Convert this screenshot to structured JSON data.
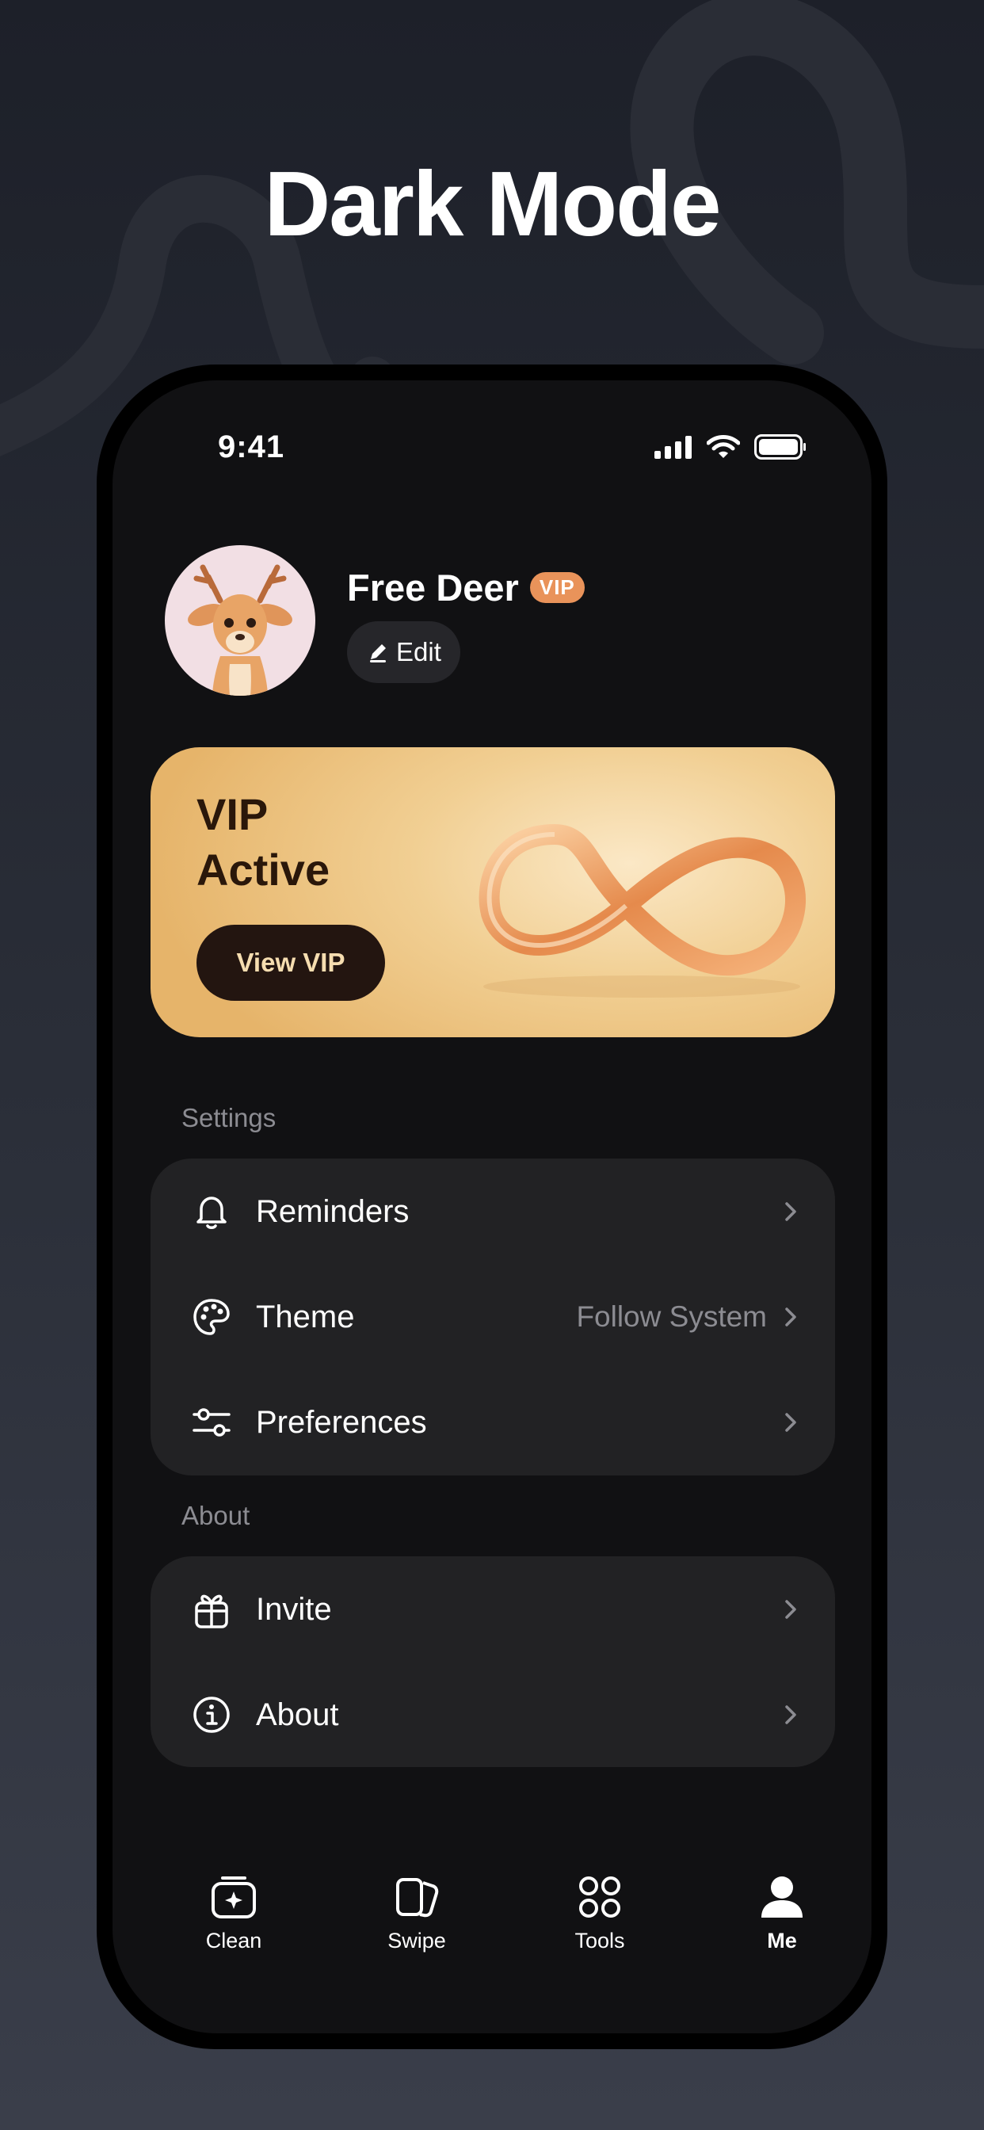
{
  "headline": "Dark Mode",
  "status_bar": {
    "time": "9:41"
  },
  "profile": {
    "name": "Free Deer",
    "badge": "VIP",
    "edit_label": "Edit"
  },
  "vip_card": {
    "title": "VIP Active",
    "button_label": "View VIP"
  },
  "settings": {
    "header": "Settings",
    "items": [
      {
        "label": "Reminders",
        "icon": "bell-icon"
      },
      {
        "label": "Theme",
        "value": "Follow System",
        "icon": "palette-icon"
      },
      {
        "label": "Preferences",
        "icon": "sliders-icon"
      }
    ]
  },
  "about": {
    "header": "About",
    "items": [
      {
        "label": "Invite",
        "icon": "gift-icon"
      },
      {
        "label": "About",
        "icon": "info-icon"
      }
    ]
  },
  "tabbar": {
    "items": [
      {
        "label": "Clean",
        "icon": "clean-icon"
      },
      {
        "label": "Swipe",
        "icon": "swipe-cards-icon"
      },
      {
        "label": "Tools",
        "icon": "grid-circles-icon"
      },
      {
        "label": "Me",
        "icon": "person-icon",
        "active": true
      }
    ]
  },
  "colors": {
    "accent_orange": "#e9935a",
    "vip_gold": "#f1cf93",
    "background": "#111113",
    "card": "#222224"
  }
}
